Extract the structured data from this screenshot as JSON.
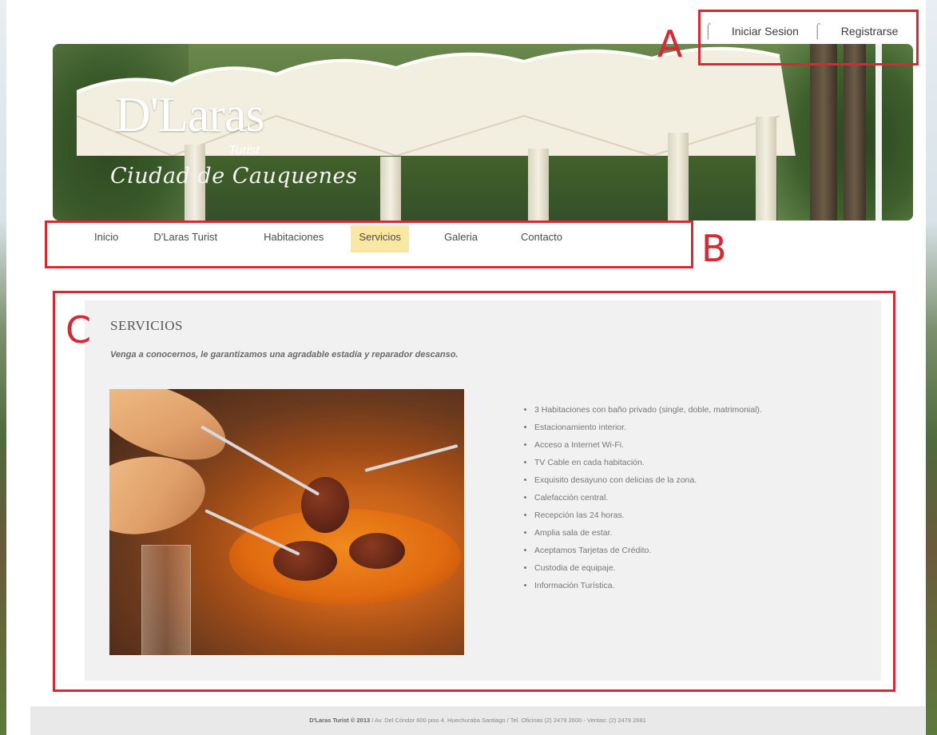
{
  "brand": {
    "logo_main": "D'Laras",
    "logo_sub": "Turist",
    "logo_city": "Ciudad de Cauquenes"
  },
  "auth": {
    "login": "Iniciar Sesion",
    "register": "Registrarse"
  },
  "annotations": {
    "a": "A",
    "b": "B",
    "c": "C"
  },
  "nav": {
    "items": [
      {
        "label": "Inicio"
      },
      {
        "label": "D'Laras Turist"
      },
      {
        "label": "Habitaciones"
      },
      {
        "label": "Servicios",
        "active": true
      },
      {
        "label": "Galeria"
      },
      {
        "label": "Contacto"
      }
    ]
  },
  "content": {
    "title": "SERVICIOS",
    "tagline": "Venga a conocernos, le garantizamos una agradable estadía y reparador descanso.",
    "services": [
      "3 Habitaciones con baño privado (single, doble, matrimonial).",
      "Estacionamiento interior.",
      "Acceso a Internet Wi-Fi.",
      "TV Cable en cada habitación.",
      "Exquisito desayuno con delicias de la zona.",
      "Calefacción central.",
      "Recepción las 24 horas.",
      "Amplia sala de estar.",
      "Aceptamos Tarjetas de Crédito.",
      "Custodia de equipaje.",
      "Información Turística."
    ]
  },
  "footer": {
    "brand": "D'Laras Turist © 2013",
    "text": " / Av. Del Cóndor 600 piso 4. Huechuraba Santiago / Tel. Oficinas (2) 2479 2600 - Ventas: (2) 2479 2681"
  },
  "colors": {
    "annotation": "#d42a35",
    "nav_active": "#fbe7a4",
    "content_bg": "#f1f1f1"
  }
}
